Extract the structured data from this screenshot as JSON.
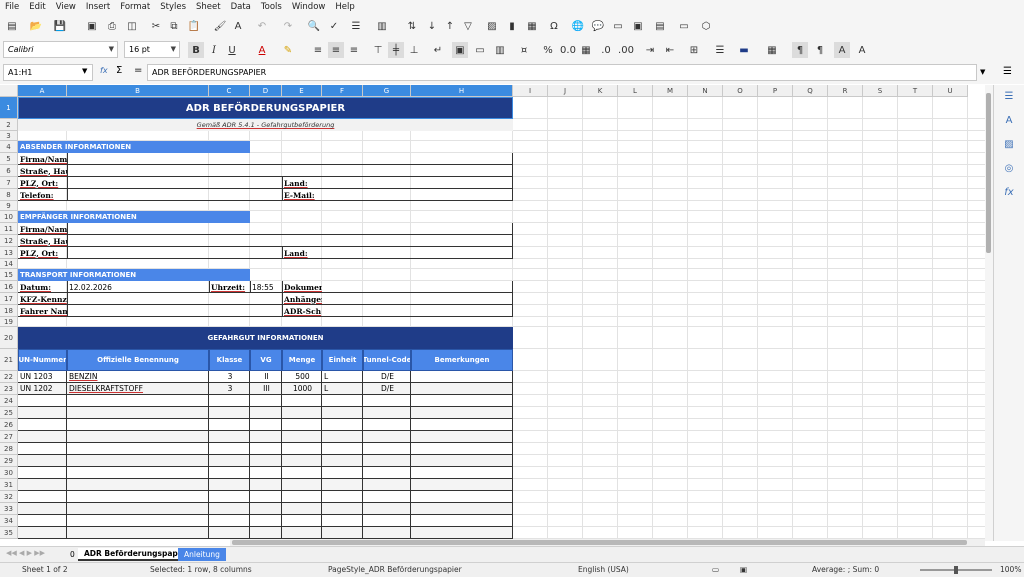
{
  "menu": [
    "File",
    "Edit",
    "View",
    "Insert",
    "Format",
    "Styles",
    "Sheet",
    "Data",
    "Tools",
    "Window",
    "Help"
  ],
  "font": {
    "name": "Calibri",
    "size": "16 pt"
  },
  "namebox": "A1:H1",
  "formula": "ADR BEFÖRDERUNGSPAPIER",
  "fx_symbols": {
    "fx": "fx",
    "sigma": "Σ",
    "eq": "="
  },
  "columns": [
    "A",
    "B",
    "C",
    "D",
    "E",
    "F",
    "G",
    "H",
    "I",
    "J",
    "K",
    "L",
    "M",
    "N",
    "O",
    "P",
    "Q",
    "R",
    "S",
    "T",
    "U"
  ],
  "rows": [
    "1",
    "2",
    "3",
    "4",
    "5",
    "6",
    "7",
    "8",
    "9",
    "10",
    "11",
    "12",
    "13",
    "14",
    "15",
    "16",
    "17",
    "18",
    "19",
    "20",
    "21",
    "22",
    "23",
    "24",
    "25",
    "26",
    "27",
    "28",
    "29",
    "30",
    "31",
    "32",
    "33",
    "34",
    "35"
  ],
  "doc": {
    "title": "ADR BEFÖRDERUNGSPAPIER",
    "subtitle": "Gemäß ADR 5.4.1 - Gefahrgutbeförderung",
    "sender_header": "ABSENDER INFORMATIONEN",
    "firma": "Firma/Nam",
    "strasse": "Straße, Hau",
    "plz": "PLZ, Ort:",
    "telefon": "Telefon:",
    "land": "Land:",
    "email": "E-Mail:",
    "recv_header": "EMPFÄNGER INFORMATIONEN",
    "firma2": "Firma/Nam",
    "strasse2": "Straße, Hau",
    "plz2": "PLZ, Ort:",
    "land2": "Land:",
    "transport_header": "TRANSPORT INFORMATIONEN",
    "datum": "Datum:",
    "datum_val": "12.02.2026",
    "uhrzeit": "Uhrzeit:",
    "uhrzeit_val": "18:55",
    "dokument": "Dokumen",
    "kfz": "KFZ-Kennz",
    "anhaenger": "Anhänger",
    "fahrer": "Fahrer Nam",
    "adr": "ADR-Sch",
    "gefahrgut_header": "GEFAHRGUT INFORMATIONEN",
    "table_headers": [
      "UN-Nummer",
      "Offizielle Benennung",
      "Klasse",
      "VG",
      "Menge",
      "Einheit",
      "Tunnel-Code",
      "Bemerkungen"
    ],
    "table_rows": [
      [
        "UN 1203",
        "BENZIN",
        "3",
        "II",
        "500",
        "L",
        "D/E",
        ""
      ],
      [
        "UN 1202",
        "DIESELKRAFTSTOFF",
        "3",
        "III",
        "1000",
        "L",
        "D/E",
        ""
      ]
    ]
  },
  "tabs": {
    "num": "0",
    "sheet1": "ADR Beförderungspapier",
    "sheet2": "Anleitung"
  },
  "status": {
    "sheet": "Sheet 1 of 2",
    "selected": "Selected: 1 row, 8 columns",
    "pagestyle": "PageStyle_ADR Beförderungspapier",
    "lang": "English (USA)",
    "sum": "Average: ; Sum: 0",
    "zoom": "100%"
  },
  "colors": {
    "header_dark": "#1f3c88",
    "section_blue": "#4a86e8",
    "selection": "#3b8be0"
  }
}
